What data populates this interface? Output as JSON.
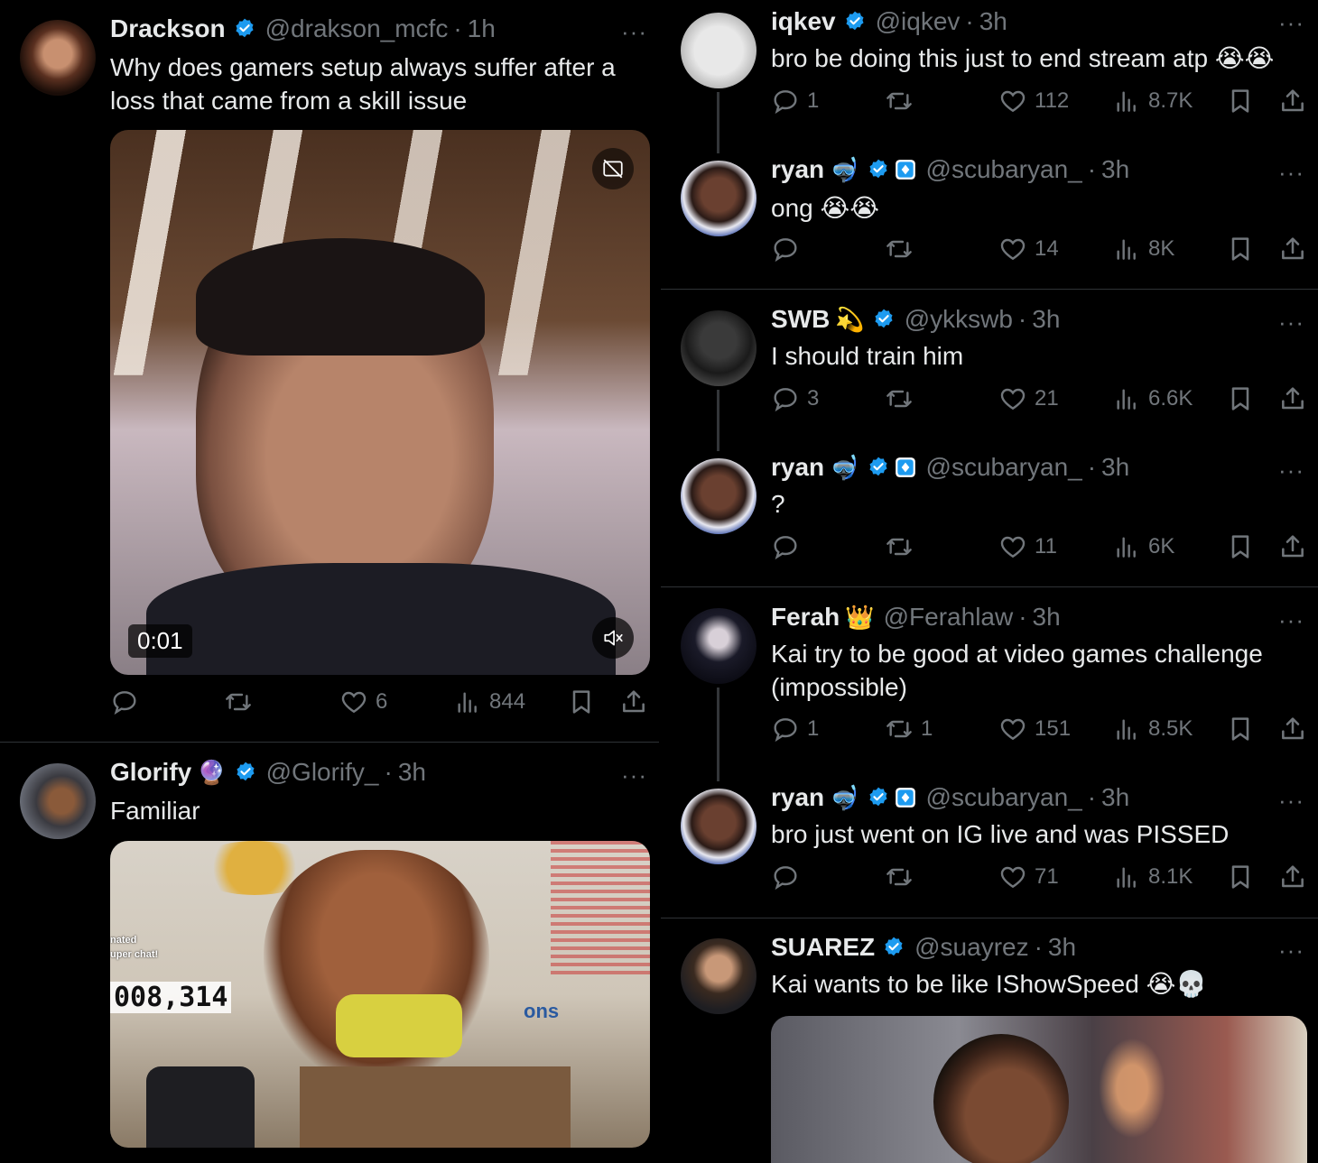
{
  "tweets": [
    {
      "name": "Drackson",
      "handle": "@drakson_mcfc",
      "time": "1h",
      "text": "Why does gamers setup always suffer after a loss that came from a skill issue",
      "video_time": "0:01",
      "replies": "",
      "retweets": "",
      "likes": "6",
      "views": "844"
    },
    {
      "name": "Glorify",
      "emoji": "🔮",
      "handle": "@Glorify_",
      "time": "3h",
      "text": "Familiar",
      "overlay_a": "nated",
      "overlay_b": "uper chat!",
      "overlay_number": "008,314",
      "overlay_word": "ons"
    },
    {
      "name": "iqkev",
      "handle": "@iqkev",
      "time": "3h",
      "text": "bro be doing this just to end stream atp 😭😭",
      "replies": "1",
      "retweets": "",
      "likes": "112",
      "views": "8.7K"
    },
    {
      "name": "ryan",
      "emoji": "🤿",
      "handle": "@scubaryan_",
      "time": "3h",
      "text": "ong 😭😭",
      "replies": "",
      "retweets": "",
      "likes": "14",
      "views": "8K"
    },
    {
      "name": "SWB",
      "emoji": "💫",
      "handle": "@ykkswb",
      "time": "3h",
      "text": "I should train him",
      "replies": "3",
      "retweets": "",
      "likes": "21",
      "views": "6.6K"
    },
    {
      "name": "ryan",
      "emoji": "🤿",
      "handle": "@scubaryan_",
      "time": "3h",
      "text": "?",
      "replies": "",
      "retweets": "",
      "likes": "11",
      "views": "6K"
    },
    {
      "name": "Ferah",
      "emoji": "👑",
      "handle": "@Ferahlaw",
      "time": "3h",
      "text": "Kai try to be good at video games challenge (impossible)",
      "replies": "1",
      "retweets": "1",
      "likes": "151",
      "views": "8.5K"
    },
    {
      "name": "ryan",
      "emoji": "🤿",
      "handle": "@scubaryan_",
      "time": "3h",
      "text": "bro just went on IG live and was PISSED",
      "replies": "",
      "retweets": "",
      "likes": "71",
      "views": "8.1K"
    },
    {
      "name": "SUAREZ",
      "handle": "@suayrez",
      "time": "3h",
      "text": "Kai wants to be like IShowSpeed 😭💀"
    }
  ],
  "dot_sep": "·",
  "more": "···",
  "colors": {
    "background": "#000000",
    "text": "#e7e9ea",
    "muted": "#71767b",
    "verified": "#1d9bf0"
  },
  "icons": [
    "verified-icon",
    "reply-icon",
    "retweet-icon",
    "like-icon",
    "views-icon",
    "bookmark-icon",
    "share-icon",
    "muted-icon",
    "gif-off-icon"
  ]
}
